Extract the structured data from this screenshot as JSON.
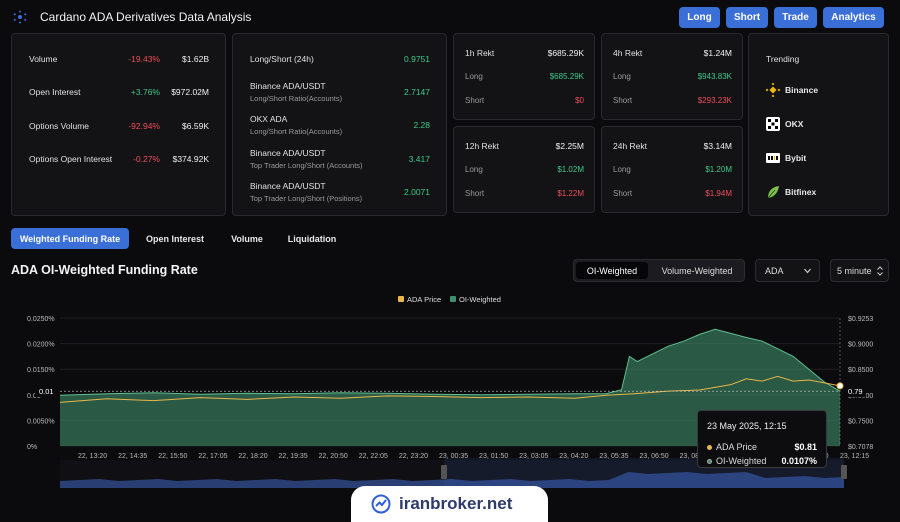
{
  "header": {
    "title": "Cardano ADA Derivatives Data Analysis",
    "buttons": [
      "Long",
      "Short",
      "Trade",
      "Analytics"
    ]
  },
  "stats": [
    {
      "label": "Volume",
      "change": "-19.43%",
      "value": "$1.62B",
      "trend": "down"
    },
    {
      "label": "Open Interest",
      "change": "+3.76%",
      "value": "$972.02M",
      "trend": "up"
    },
    {
      "label": "Options Volume",
      "change": "-92.94%",
      "value": "$6.59K",
      "trend": "down"
    },
    {
      "label": "Options Open Interest",
      "change": "-0.27%",
      "value": "$374.92K",
      "trend": "down"
    }
  ],
  "ratios": [
    {
      "title": "Long/Short (24h)",
      "sub": "",
      "value": "0.9751"
    },
    {
      "title": "Binance ADA/USDT",
      "sub": "Long/Short Ratio(Accounts)",
      "value": "2.7147"
    },
    {
      "title": "OKX ADA",
      "sub": "Long/Short Ratio(Accounts)",
      "value": "2.28"
    },
    {
      "title": "Binance ADA/USDT",
      "sub": "Top Trader Long/Short (Accounts)",
      "value": "3.417"
    },
    {
      "title": "Binance ADA/USDT",
      "sub": "Top Trader Long/Short (Positions)",
      "value": "2.0071"
    }
  ],
  "rekt": [
    {
      "title": "1h Rekt",
      "total": "$685.29K",
      "long": "$685.29K",
      "short": "$0"
    },
    {
      "title": "4h Rekt",
      "total": "$1.24M",
      "long": "$943.83K",
      "short": "$293.23K"
    },
    {
      "title": "12h Rekt",
      "total": "$2.25M",
      "long": "$1.02M",
      "short": "$1.22M"
    },
    {
      "title": "24h Rekt",
      "total": "$3.14M",
      "long": "$1.20M",
      "short": "$1.94M"
    }
  ],
  "rekt_labels": {
    "long": "Long",
    "short": "Short"
  },
  "trending": {
    "title": "Trending",
    "items": [
      {
        "name": "Binance",
        "icon": "binance-icon"
      },
      {
        "name": "OKX",
        "icon": "okx-icon"
      },
      {
        "name": "Bybit",
        "icon": "bybit-icon"
      },
      {
        "name": "Bitfinex",
        "icon": "bitfinex-icon"
      }
    ]
  },
  "tabs": [
    "Weighted Funding Rate",
    "Open Interest",
    "Volume",
    "Liquidation"
  ],
  "chart_section": {
    "title": "ADA OI-Weighted Funding Rate",
    "segments": [
      "OI-Weighted",
      "Volume-Weighted"
    ],
    "asset": "ADA",
    "interval": "5 minute"
  },
  "colors": {
    "accent": "#3a6fd8",
    "price": "#e8b64a",
    "oi": "#3f8e6c",
    "red": "#ef4d5a",
    "green": "#3fc98a"
  },
  "chart_data": {
    "type": "area",
    "legend": [
      "ADA Price",
      "OI-Weighted"
    ],
    "legend_position": "top-center",
    "x_ticks": [
      "22, 13:20",
      "22, 14:35",
      "22, 15:50",
      "22, 17:05",
      "22, 18:20",
      "22, 19:35",
      "22, 20:50",
      "22, 22:05",
      "22, 23:20",
      "23, 00:35",
      "23, 01:50",
      "23, 03:05",
      "23, 04:20",
      "23, 05:35",
      "23, 06:50",
      "23, 08:05",
      "23, 09:20",
      "23, 10:35",
      "23, 11:50",
      "23, 12:15"
    ],
    "y_left_ticks": [
      "0.0250%",
      "0.0200%",
      "0.0150%",
      "0.01",
      "0.0050%",
      "0%"
    ],
    "y_right_ticks": [
      "$0.9253",
      "$0.9000",
      "$0.8500",
      "$0.8000",
      "$0.7500",
      "$0.7078"
    ],
    "y_left_range": [
      0,
      0.025
    ],
    "y_right_range": [
      0.7078,
      0.9253
    ],
    "current_left_label": "0.01",
    "current_right_label": "0.79",
    "x_index_range": [
      0,
      100
    ],
    "series": [
      {
        "name": "OI-Weighted",
        "axis": "left",
        "x": [
          0,
          6,
          12,
          18,
          24,
          30,
          36,
          42,
          48,
          54,
          60,
          66,
          70,
          72,
          73,
          74,
          76,
          78,
          80,
          82,
          84,
          86,
          88,
          90,
          92,
          94,
          96,
          98,
          100
        ],
        "y": [
          0.0099,
          0.0102,
          0.0104,
          0.0101,
          0.0103,
          0.0102,
          0.0104,
          0.0103,
          0.0101,
          0.01,
          0.0101,
          0.0102,
          0.0102,
          0.011,
          0.0175,
          0.0165,
          0.018,
          0.0195,
          0.0205,
          0.0218,
          0.0228,
          0.022,
          0.0212,
          0.0205,
          0.019,
          0.0175,
          0.015,
          0.0125,
          0.0107
        ]
      },
      {
        "name": "ADA Price",
        "axis": "right",
        "x": [
          0,
          6,
          12,
          18,
          24,
          30,
          36,
          42,
          48,
          54,
          60,
          66,
          70,
          74,
          78,
          82,
          86,
          88,
          90,
          92,
          94,
          96,
          98,
          100
        ],
        "y": [
          0.782,
          0.788,
          0.785,
          0.79,
          0.787,
          0.791,
          0.789,
          0.793,
          0.792,
          0.79,
          0.791,
          0.789,
          0.794,
          0.797,
          0.801,
          0.803,
          0.812,
          0.822,
          0.818,
          0.826,
          0.818,
          0.82,
          0.815,
          0.81
        ]
      }
    ]
  },
  "tooltip": {
    "title": "23 May 2025, 12:15",
    "rows": [
      {
        "label": "ADA Price",
        "value": "$0.81"
      },
      {
        "label": "OI-Weighted",
        "value": "0.0107%"
      }
    ]
  },
  "watermark": {
    "text": "iranbroker.net"
  }
}
